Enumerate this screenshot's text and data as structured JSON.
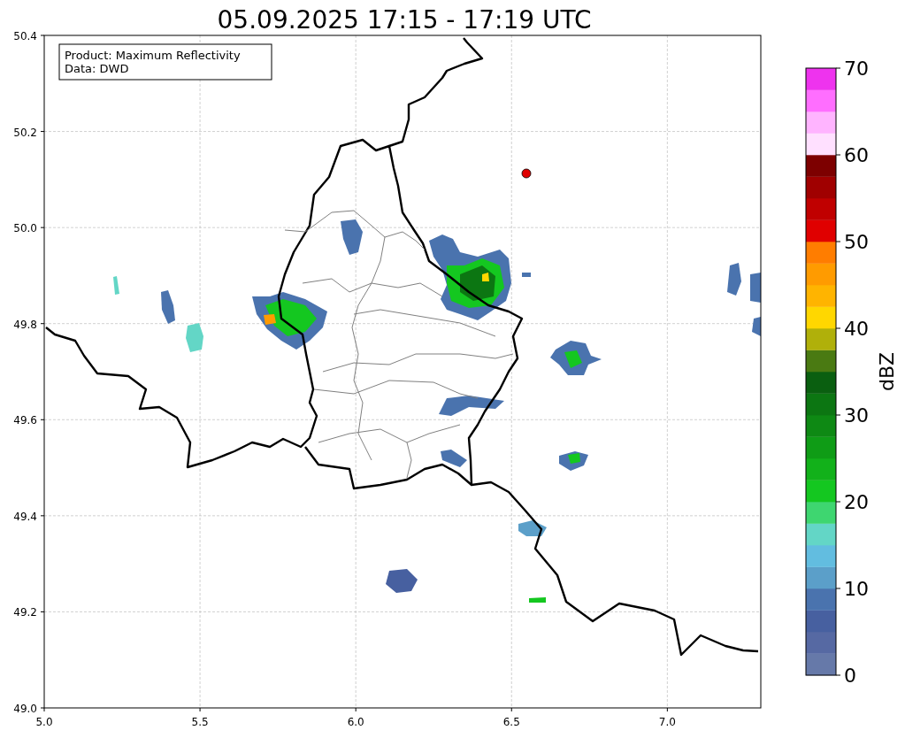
{
  "title": "05.09.2025 17:15 - 17:19 UTC",
  "info_box": {
    "lines": [
      "Product: Maximum Reflectivity",
      "Data: DWD"
    ]
  },
  "map": {
    "x_ticks": [
      "5.0",
      "5.5",
      "6.0",
      "6.5",
      "7.0"
    ],
    "y_ticks": [
      "50.4",
      "50.2",
      "50.0",
      "49.8",
      "49.6",
      "49.4",
      "49.2",
      "49.0"
    ]
  },
  "colorbar": {
    "label": "dBZ",
    "ticks": [
      "70",
      "60",
      "50",
      "40",
      "30",
      "20",
      "10",
      "0"
    ],
    "bins": [
      {
        "color": "#6679a9"
      },
      {
        "color": "#5669a3"
      },
      {
        "color": "#4760a0"
      },
      {
        "color": "#4a73ae"
      },
      {
        "color": "#5b9fc9"
      },
      {
        "color": "#62bde0"
      },
      {
        "color": "#63d6c6"
      },
      {
        "color": "#3ed670"
      },
      {
        "color": "#14c720"
      },
      {
        "color": "#12b11a"
      },
      {
        "color": "#0f9c16"
      },
      {
        "color": "#0e8914"
      },
      {
        "color": "#0c7612"
      },
      {
        "color": "#0a5f10"
      },
      {
        "color": "#4a7a12"
      },
      {
        "color": "#b0b00a"
      },
      {
        "color": "#ffd700"
      },
      {
        "color": "#ffb400"
      },
      {
        "color": "#ff9b00"
      },
      {
        "color": "#ff7d00"
      },
      {
        "color": "#e00000"
      },
      {
        "color": "#c00000"
      },
      {
        "color": "#a00000"
      },
      {
        "color": "#7d0000"
      },
      {
        "color": "#ffe0ff"
      },
      {
        "color": "#ffb4ff"
      },
      {
        "color": "#ff6eff"
      },
      {
        "color": "#ee33ee"
      }
    ]
  }
}
